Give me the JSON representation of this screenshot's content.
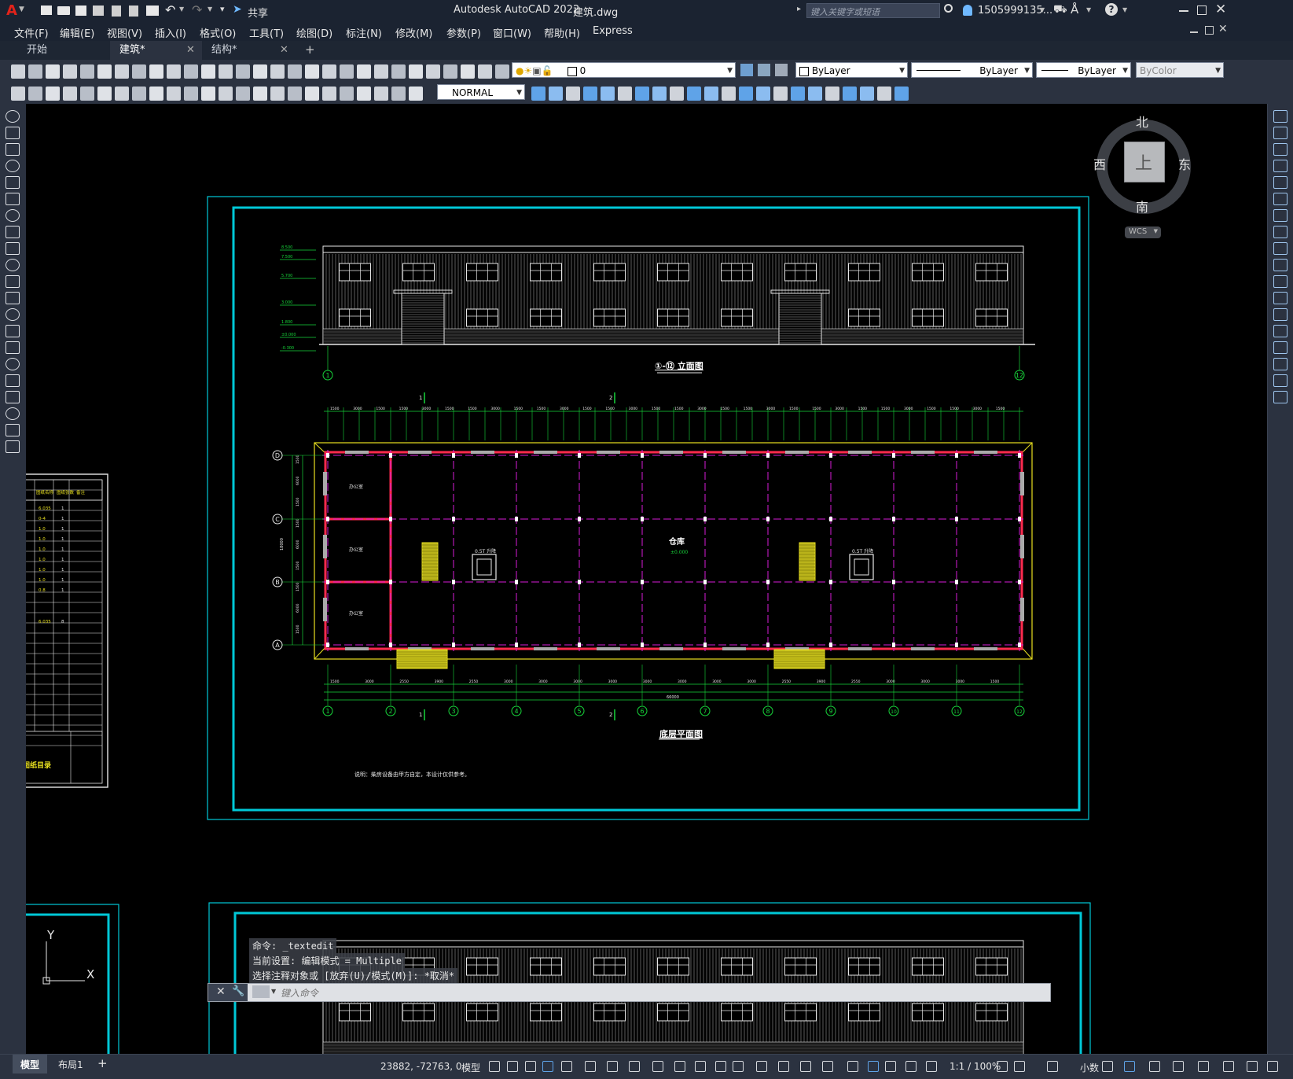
{
  "app": {
    "logo": "A",
    "title": "Autodesk AutoCAD 2022",
    "filename": "建筑.dwg",
    "share_label": "共享",
    "search_placeholder": "键入关键字或短语",
    "user": "1505999135...",
    "help_icon": "?"
  },
  "menu": [
    "文件(F)",
    "编辑(E)",
    "视图(V)",
    "插入(I)",
    "格式(O)",
    "工具(T)",
    "绘图(D)",
    "标注(N)",
    "修改(M)",
    "参数(P)",
    "窗口(W)",
    "帮助(H)",
    "Express"
  ],
  "tabs": [
    {
      "label": "开始",
      "active": false
    },
    {
      "label": "建筑*",
      "active": true
    },
    {
      "label": "结构*",
      "active": false
    }
  ],
  "tab_add": "+",
  "toolbar": {
    "layer_value": "0",
    "color_value": "ByLayer",
    "linetype_value": "ByLayer",
    "lineweight_value": "ByLayer",
    "plotstyle_value": "ByColor",
    "dimstyle_value": "NORMAL"
  },
  "viewcube": {
    "north": "北",
    "south": "南",
    "east": "东",
    "west": "西",
    "top_face": "上",
    "wcs": "WCS"
  },
  "drawing": {
    "elevation_title": "①-⑫ 立面图",
    "plan_title": "底层平面图",
    "plan_room_label": "仓库",
    "plan_elevation_mark": "±0.000",
    "note": "说明：柴房设备由甲方自定，本设计仅供参考。",
    "axis_top": [
      "1",
      "2"
    ],
    "axis_bottom": [
      "1",
      "2"
    ],
    "axis_numbers": [
      "1",
      "2",
      "3",
      "4",
      "5",
      "6",
      "7",
      "8",
      "9",
      "10",
      "11",
      "12"
    ],
    "axis_letters": [
      "D",
      "C",
      "B",
      "A"
    ],
    "elevation_axes": [
      "1",
      "12"
    ],
    "top_dims": [
      "1500",
      "3000",
      "1500",
      "1500",
      "3000",
      "1500",
      "1500",
      "3000",
      "1500",
      "1500",
      "3000",
      "1500",
      "1500",
      "3000",
      "1500",
      "1500",
      "3000",
      "1500",
      "1500",
      "3000",
      "1500",
      "1500",
      "3000",
      "1500",
      "1500",
      "3000",
      "1500",
      "1500",
      "3000",
      "1500"
    ],
    "bottom_dims": [
      "1500",
      "3000",
      "2550",
      "3900",
      "2550",
      "3000",
      "3000",
      "3000",
      "3000",
      "3000",
      "3000",
      "3000",
      "3000",
      "2550",
      "3900",
      "2550",
      "3000",
      "3000",
      "3000",
      "1500"
    ],
    "bottom_total": "66000",
    "left_dims": [
      "1500",
      "6000",
      "1500",
      "1500",
      "6000",
      "1500",
      "1500",
      "6000",
      "1500"
    ],
    "left_total": "18000",
    "elev_levels": [
      "8.500",
      "7.500",
      "5.700",
      "3.000",
      "1.800",
      "±0.000",
      "-0.300"
    ],
    "lift_label": "0.5T 升降",
    "side_room": "办公室"
  },
  "sidepanel": {
    "header": [
      "图纸名称",
      "图纸张数",
      "备注"
    ],
    "rows": [
      [
        "6.035",
        "1"
      ],
      [
        "0-4",
        "1"
      ],
      [
        "1.0",
        "1"
      ],
      [
        "1.0",
        "1"
      ],
      [
        "1.0",
        "1"
      ],
      [
        "1.0",
        "1"
      ],
      [
        "1.0",
        "1"
      ],
      [
        "1.0",
        "1"
      ],
      [
        "0.8",
        "1"
      ],
      [
        "6.035",
        "8"
      ]
    ],
    "footer": "图纸目录"
  },
  "ucs": {
    "y": "Y",
    "x": "X"
  },
  "command": {
    "line1": "命令: _textedit",
    "line2": "当前设置: 编辑模式 = Multiple",
    "line3": "选择注释对象或 [放弃(U)/模式(M)]: *取消*",
    "placeholder": "键入命令"
  },
  "status": {
    "model_tab": "模型",
    "layout_tab": "布局1",
    "coords": "23882, -72763, 0",
    "space": "模型",
    "scale": "1:1 / 100%",
    "units": "小数"
  },
  "colors": {
    "frame_cyan": "#00c8d7",
    "axis_green": "#17d53a",
    "grid_magenta": "#d81bd8",
    "wall_red": "#ff2a4d",
    "yellow": "#e8e020",
    "white": "#e8e8e8"
  }
}
